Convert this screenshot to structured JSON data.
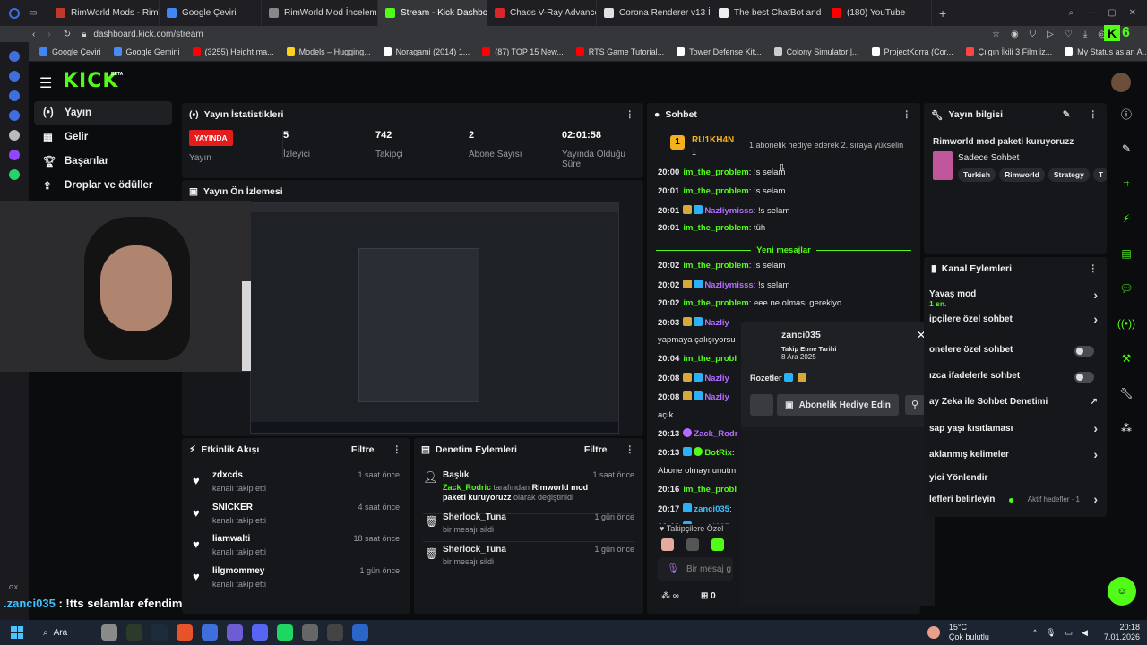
{
  "browser": {
    "tabs": [
      {
        "label": "RimWorld Mods - RimWorld",
        "color": "#c0392b",
        "active": false
      },
      {
        "label": "Google Çeviri",
        "color": "#4285f4",
        "active": false
      },
      {
        "label": "RimWorld Mod İncelemesi",
        "color": "#888888",
        "active": false
      },
      {
        "label": "Stream - Kick Dashboard",
        "color": "#53fc18",
        "active": true
      },
      {
        "label": "Chaos V-Ray Advanced F",
        "color": "#d8262a",
        "active": false
      },
      {
        "label": "Corona Renderer v13 İnd",
        "color": "#e0e0e0",
        "active": false
      },
      {
        "label": "The best ChatBot and Wid",
        "color": "#eeeeee",
        "active": false
      },
      {
        "label": "(180) YouTube",
        "color": "#ff0000",
        "active": false
      }
    ],
    "url": "dashboard.kick.com/stream",
    "bookmarks": [
      "Google Çeviri",
      "Google Gemini",
      "(3255) Height ma...",
      "Models – Hugging...",
      "Noragami (2014) 1...",
      "(87) TOP 15 New...",
      "RTS Game Tutorial...",
      "Tower Defense Kit...",
      "Colony Simulator |...",
      "ProjectKorra (Cor...",
      "Çılgın İkili 3 Film iz...",
      "My Status as an A..."
    ]
  },
  "header": {
    "logo": "KICK",
    "beta": "BETA"
  },
  "nav": {
    "items": [
      {
        "label": "Yayın",
        "icon": "broadcast-icon",
        "selected": true
      },
      {
        "label": "Gelir",
        "icon": "revenue-icon",
        "selected": false
      },
      {
        "label": "Başarılar",
        "icon": "trophy-icon",
        "selected": false
      },
      {
        "label": "Droplar ve ödüller",
        "icon": "gift-icon",
        "selected": false
      }
    ]
  },
  "stats": {
    "title": "Yayın İstatistikleri",
    "live_badge": "YAYINDA",
    "live_label": "Yayın",
    "viewers": {
      "value": "5",
      "label": "İzleyici"
    },
    "followers": {
      "value": "742",
      "label": "Takipçi"
    },
    "subs": {
      "value": "2",
      "label": "Abone Sayısı"
    },
    "uptime": {
      "value": "02:01:58",
      "label": "Yayında Olduğu Süre"
    }
  },
  "preview": {
    "title": "Yayın Ön İzlemesi"
  },
  "activity": {
    "title": "Etkinlik Akışı",
    "filter": "Filtre",
    "items": [
      {
        "name": "zdxcds",
        "action": "kanalı takip etti",
        "time": "1 saat önce"
      },
      {
        "name": "SNICKER",
        "action": "kanalı takip etti",
        "time": "4 saat önce"
      },
      {
        "name": "liamwalti",
        "action": "kanalı takip etti",
        "time": "18 saat önce"
      },
      {
        "name": "lilgmommey",
        "action": "kanalı takip etti",
        "time": "1 gün önce"
      }
    ]
  },
  "moderation": {
    "title": "Denetim Eylemleri",
    "filter": "Filtre",
    "items": [
      {
        "title": "Başlık",
        "time": "1 saat önce",
        "actor": "Zack_Rodric",
        "mid": " tarafından ",
        "value": "Rimworld mod paketi kuruyoruzz",
        "tail": " olarak değiştirildi"
      },
      {
        "title": "Sherlock_Tuna",
        "time": "1 gün önce",
        "desc": "bir mesajı sildi"
      },
      {
        "title": "Sherlock_Tuna",
        "time": "1 gün önce",
        "desc": "bir mesajı sildi"
      }
    ]
  },
  "chat": {
    "title": "Sohbet",
    "pinned_user": "RU1KH4N",
    "pinned_rank": "1",
    "pinned_count": "1",
    "pinned_text": "1 abonelik hediye ederek 2. sıraya yükselin",
    "new_messages": "Yeni mesajlar",
    "lines": [
      {
        "time": "20:00",
        "user": "im_the_problem",
        "color": "green",
        "badges": [],
        "msg": ": !s selam"
      },
      {
        "time": "20:01",
        "user": "im_the_problem",
        "color": "green",
        "badges": [],
        "msg": ": !s selam"
      },
      {
        "time": "20:01",
        "user": "Nazliymisss",
        "color": "purple",
        "badges": [
          "crown",
          "verif"
        ],
        "msg": ": !s selam"
      },
      {
        "time": "20:01",
        "user": "im_the_problem",
        "color": "green",
        "badges": [],
        "msg": ": tüh"
      },
      {
        "time": "20:02",
        "user": "im_the_problem",
        "color": "green",
        "badges": [],
        "msg": ": !s selam"
      },
      {
        "time": "20:02",
        "user": "Nazliymisss",
        "color": "purple",
        "badges": [
          "crown",
          "verif"
        ],
        "msg": ": !s selam"
      },
      {
        "time": "20:02",
        "user": "im_the_problem",
        "color": "green",
        "badges": [],
        "msg": ": eee ne olması gerekiyo"
      },
      {
        "time": "20:03",
        "user": "Nazliy",
        "color": "purple",
        "badges": [
          "crown",
          "verif"
        ],
        "msg": ""
      },
      {
        "time": "",
        "user": "",
        "color": "green",
        "badges": [],
        "msg": "yapmaya çalışıyorsu"
      },
      {
        "time": "20:04",
        "user": "im_the_probl",
        "color": "green",
        "badges": [],
        "msg": ""
      },
      {
        "time": "20:08",
        "user": "Nazliy",
        "color": "purple",
        "badges": [
          "crown",
          "verif"
        ],
        "msg": ""
      },
      {
        "time": "20:08",
        "user": "Nazliy",
        "color": "purple",
        "badges": [
          "crown",
          "verif"
        ],
        "msg": ""
      },
      {
        "time": "",
        "user": "",
        "color": "green",
        "badges": [],
        "msg": "açık"
      },
      {
        "time": "20:13",
        "user": "Zack_Rodr",
        "color": "purple",
        "badges": [
          "mic"
        ],
        "msg": ""
      },
      {
        "time": "20:13",
        "user": "BotRix",
        "color": "green",
        "badges": [
          "verif",
          "check"
        ],
        "msg": ":"
      },
      {
        "time": "",
        "user": "",
        "color": "green",
        "badges": [],
        "msg": "Abone olmayı unutm"
      },
      {
        "time": "20:16",
        "user": "im_the_probl",
        "color": "green",
        "badges": [],
        "msg": ""
      },
      {
        "time": "20:17",
        "user": "zanci035",
        "color": "cyan",
        "badges": [
          "verif"
        ],
        "msg": ":"
      },
      {
        "time": "20:18",
        "user": "zanci035",
        "color": "cyan",
        "badges": [
          "verif"
        ],
        "msg": ":"
      }
    ],
    "followers_only": "Takipçilere Özel",
    "input_placeholder": "Bir mesaj g",
    "points": "0"
  },
  "user_card": {
    "username": "zanci035",
    "follow_label": "Takip Etme Tarihi",
    "follow_date": "8 Ara 2025",
    "badges_label": "Rozetler",
    "gift_button": "Abonelik Hediye Edin"
  },
  "stream_info": {
    "title": "Yayın bilgisi",
    "stream_title": "Rimworld mod paketi kuruyoruzz",
    "category": "Sadece Sohbet",
    "tags": [
      "Turkish",
      "Rimworld",
      "Strategy",
      "T"
    ]
  },
  "channel_actions": {
    "title": "Kanal Eylemleri",
    "rows": [
      {
        "label": "Yavaş mod",
        "sub": "1 sn.",
        "control": "chevron"
      },
      {
        "label": "ipçilere özel sohbet",
        "sub": "",
        "control": "chevron"
      },
      {
        "label": "onelere özel sohbet",
        "sub": "",
        "control": "toggle"
      },
      {
        "label": "ızca ifadelerle sohbet",
        "sub": "",
        "control": "toggle"
      },
      {
        "label": "ay Zeka ile Sohbet Denetimi",
        "sub": "",
        "control": "external"
      },
      {
        "label": "sap yaşı kısıtlaması",
        "sub": "",
        "control": "chevron"
      },
      {
        "label": "aklanmış kelimeler",
        "sub": "",
        "control": "chevron"
      },
      {
        "label": "yici Yönlendir",
        "sub": "",
        "control": "none"
      },
      {
        "label": "lefleri belirleyin",
        "sub": "Aktif hedefler · 1",
        "control": "chevron"
      }
    ]
  },
  "overlay": {
    "caption_user": ".zanci035",
    "caption_text": " : !tts selamlar efendim",
    "tag": "GX"
  },
  "taskbar": {
    "search": "Ara",
    "weather_temp": "15°C",
    "weather_desc": "Çok bulutlu",
    "time": "20:18",
    "date": "7.01.2026"
  }
}
